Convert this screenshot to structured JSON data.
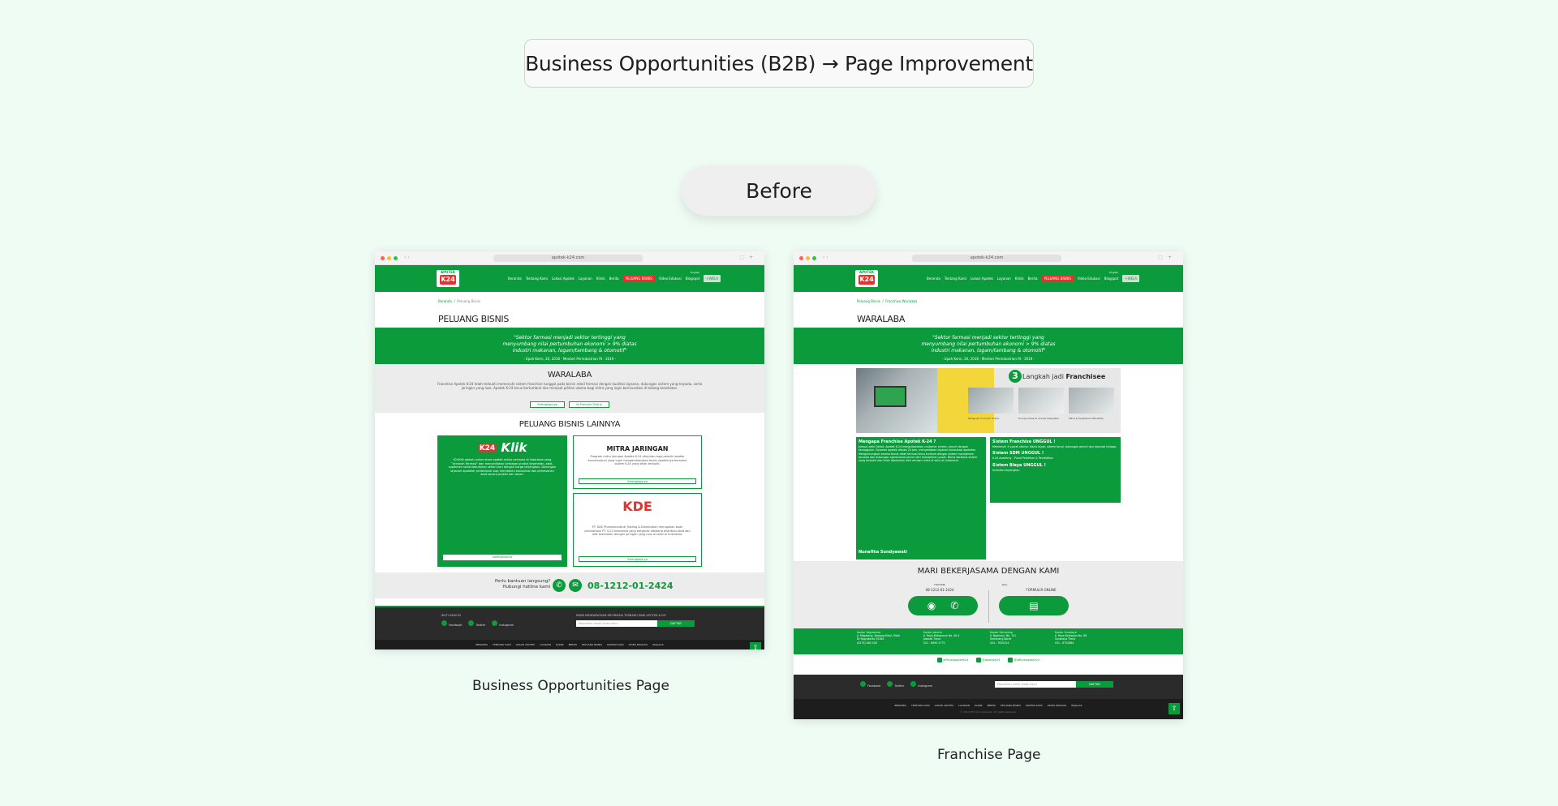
{
  "header": {
    "title": "Business Opportunities (B2B) → Page Improvement",
    "before_label": "Before"
  },
  "captions": {
    "left": "Business Opportunities Page",
    "right": "Franchise Page"
  },
  "browser": {
    "url": "apotek-k24.com"
  },
  "site": {
    "logo_top": "APOTEK",
    "logo_main": "K24",
    "lang": "English",
    "menu": [
      "Beranda",
      "Tentang Kami",
      "Lokasi Apotek",
      "Layanan",
      "Klinik",
      "Berita"
    ],
    "menu_hot": "PELUANG BISNIS",
    "menu_more": [
      "Video Edukasi",
      "Blogspot"
    ],
    "menu_btn": "+WELA"
  },
  "page1": {
    "breadcrumb": [
      "Beranda",
      "Peluang Bisnis"
    ],
    "heading": "PELUANG BISNIS",
    "quote": "\"Sektor farmasi menjadi sektor tertinggi yang menyumbang nilai pertumbuhan ekonomi > 9% diatas industri makanan, logam/tambang & otomotif\"",
    "quote_src": "- Upah Kerin, 20, 2018 - Menteri Perindustrian RI - 2019 -",
    "waralaba": {
      "heading": "WARALABA",
      "body": "Franchise Apotek K-24 telah terbukti memenuhi sistem franchise tunggal pada bisnis retail farmasi dengan kualitas layanan, dukungan sistem yang terpadu, serta jaringan yang luas. Apotek K-24 terus bertumbuh dan menjadi pilihan utama bagi mitra yang ingin berinvestasi di bidang kesehatan.",
      "btn1": "Selengkapnya",
      "btn2": "Isi Formulir Online"
    },
    "lainnya": {
      "heading": "PELUANG BISNIS LAINNYA",
      "klik_logo": "K24",
      "klik_word": "Klik",
      "klik_body": "K24Klik adalah online store apotek online pertama di Indonesia yang \"Amanah Farmasi\" dan menyediakan berbagai produk kesehatan, obat, suplemen serta kebutuhan sehari-hari dengan harga terjangkau. Dukungan layanan apoteker profesional siap membantu konsultasi dan pemesanan obat secara praktis dan aman.",
      "klik_btn": "Selengkapnya",
      "mitra_h": "MITRA JARINGAN",
      "mitra_body": "Program mitra jaringan Apotek K-24 ditujukan bagi pemilik apotek konvensional yang ingin mengembangkan bisnis Apoteknya bersama sistem K-24 yang telah terbukti.",
      "mitra_btn": "Selengkapnya",
      "kde_logo": "KDE",
      "kde_body": "PT. KDE Pharmaceutical Trading & Distribution merupakan anak perusahaan PT. K-24 Indonesia yang bergerak dibidang distribusi obat dan alat kesehatan dengan jaringan yang luas di seluruh Indonesia.",
      "kde_btn": "Selengkapnya"
    },
    "hotline": {
      "text1": "Perlu bantuan langsung?",
      "text2": "Hubungi hotline kami",
      "number": "08-1212-01-2424"
    }
  },
  "footer": {
    "follow": "IKUTI KAMI DI",
    "social": [
      "Facebook",
      "Twitter",
      "Instagram"
    ],
    "newsletter": "INGIN MENDAPATKAN INFORMASI TERBARU DARI APOTEK K-24?",
    "email_ph": "Masukkan email Anda disini",
    "submit": "DAFTAR",
    "links": [
      "BERANDA",
      "TENTANG KAMI",
      "LOKASI APOTEK",
      "LAYANAN",
      "KLINIK",
      "BERITA",
      "PELUANG BISNIS",
      "KONTAK KAMI",
      "VIDEO EDUKASI",
      "WAJALAS"
    ],
    "copyright": "© 2019 PT K-24 Indonesia. All rights reserved."
  },
  "page2": {
    "breadcrumb": [
      "Peluang Bisnis",
      "Franchise Waralaba"
    ],
    "heading": "WARALABA",
    "quote": "\"Sektor farmasi menjadi sektor tertinggi yang menyumbang nilai pertumbuhan ekonomi > 9% diatas industri makanan, logam/tambang & otomotif\"",
    "quote_src": "- Upah Kerin, 20, 2018 - Menteri Perindustrian RI - 2019 -",
    "steps_num": "3",
    "steps_title_a": "Langkah jadi ",
    "steps_title_b": "Franchisee",
    "steps": [
      "Pengisian Formulir Online",
      "Survey lokasi & review kelayakan",
      "Mitra & Kerjasama Waralaba"
    ],
    "why_h": "Mengapa Franchise Apotek K-24 ?",
    "why_body": "Jumpa Lebih Dekat, Apotek K-24 mengutamakan customer centric, penuh dengan keunggulan. Nyaman apotek dibuka 24 jam, menyediakan layanan konsultasi apoteker. Menguntungkan karena bisnis retail farmasi terus tumbuh dengan sistem manajemen terpadu dan dukungan operasional penuh dari manajemen pusat. Bisnis berbasis sistem yang terbukti dan telah dijalankan oleh ratusan mitra di seluruh Indonesia.",
    "why_sig": "Nunafika Sundyawati",
    "sys": [
      {
        "h": "Sistem Franchise UNGGUL !",
        "p": "Memenuhi 4 syarat utama: bisnis layak, sistem teruji, dukungan penuh dan reputasi terjaga."
      },
      {
        "h": "Sistem SDM UNGGUL !",
        "p": "K-24 Academy - Pusat Pelatihan & Pendidikan"
      },
      {
        "h": "Sistem Biaya UNGGUL !",
        "p": "Investasi terjangkau"
      }
    ],
    "mari": {
      "heading": "MARI BEKERJASAMA DENGAN KAMI",
      "hotline_lbl": "HOTLINE",
      "hotline_num": "08-1212-01-2424",
      "or": "atau",
      "form_lbl": "FORMULIR ONLINE"
    },
    "offices": [
      {
        "h": "Kantor Yogyakarta",
        "l1": "Jl. Magelang, Kawang Kidul, Mlati",
        "l2": "DI Yogyakarta 55284",
        "l3": "(0274) 484 528"
      },
      {
        "h": "Kantor Jakarta",
        "l1": "Jl. Raya Kebayoran No. 40 A",
        "l2": "Jakarta Timur",
        "l3": "021 - 8690 2775"
      },
      {
        "h": "Kantor Semarang",
        "l1": "Jl. Ngaliyan, No. 101",
        "l2": "Semarang Barat",
        "l3": "024 - 7620224"
      },
      {
        "h": "Kantor Surabaya",
        "l1": "Jl. Raya Kertajaya No. 86",
        "l2": "Surabaya Timur",
        "l3": "031 - 6752864"
      }
    ],
    "handles": [
      "/officialapotekk24",
      "@apotekk24",
      "@officialapotek24"
    ]
  }
}
